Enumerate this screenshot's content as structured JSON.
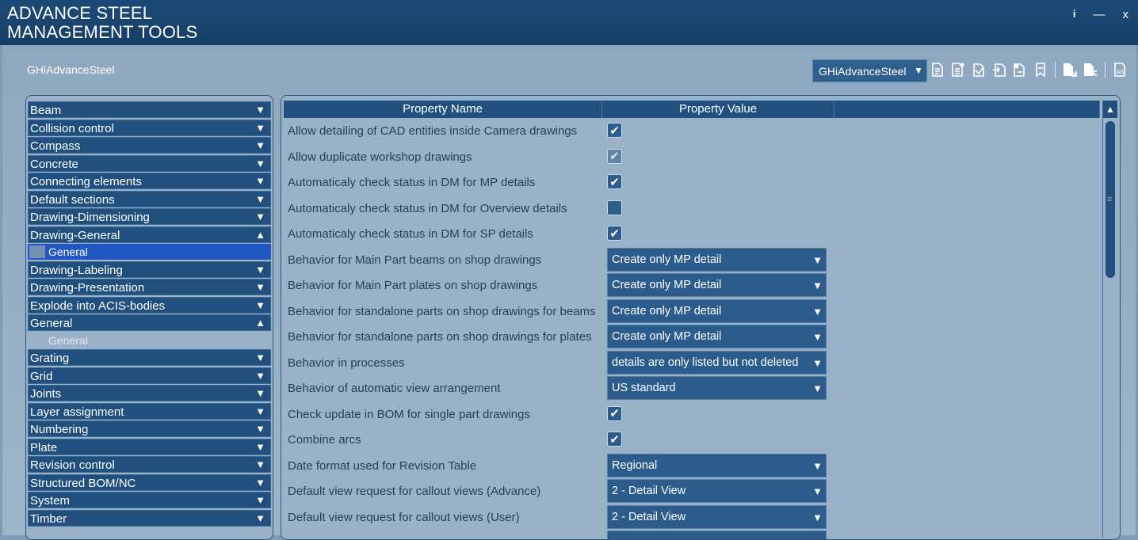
{
  "window": {
    "title_line1": "ADVANCE STEEL",
    "title_line2": "MANAGEMENT TOOLS",
    "info": "i",
    "minimize": "—",
    "close": "x"
  },
  "profile": {
    "label": "GHiAdvanceSteel",
    "selected": "GHiAdvanceSteel",
    "arrow": "▼"
  },
  "categories": [
    {
      "label": "Beam",
      "chevron": "▼"
    },
    {
      "label": "Collision control",
      "chevron": "▼"
    },
    {
      "label": "Compass",
      "chevron": "▼"
    },
    {
      "label": "Concrete",
      "chevron": "▼"
    },
    {
      "label": "Connecting elements",
      "chevron": "▼"
    },
    {
      "label": "Default sections",
      "chevron": "▼"
    },
    {
      "label": "Drawing-Dimensioning",
      "chevron": "▼"
    },
    {
      "label": "Drawing-General",
      "chevron": "▲",
      "sub": "General"
    },
    {
      "label": "Drawing-Labeling",
      "chevron": "▼"
    },
    {
      "label": "Drawing-Presentation",
      "chevron": "▼"
    },
    {
      "label": "Explode into ACIS-bodies",
      "chevron": "▼"
    },
    {
      "label": "General",
      "chevron": "▲",
      "sub": "General"
    },
    {
      "label": "Grating",
      "chevron": "▼"
    },
    {
      "label": "Grid",
      "chevron": "▼"
    },
    {
      "label": "Joints",
      "chevron": "▼"
    },
    {
      "label": "Layer assignment",
      "chevron": "▼"
    },
    {
      "label": "Numbering",
      "chevron": "▼"
    },
    {
      "label": "Plate",
      "chevron": "▼"
    },
    {
      "label": "Revision control",
      "chevron": "▼"
    },
    {
      "label": "Structured BOM/NC",
      "chevron": "▼"
    },
    {
      "label": "System",
      "chevron": "▼"
    },
    {
      "label": "Timber",
      "chevron": "▼"
    }
  ],
  "grid": {
    "col_name": "Property Name",
    "col_value": "Property Value",
    "rows": [
      {
        "name": "Allow detailing of CAD entities inside Camera drawings",
        "checked": true
      },
      {
        "name": "Allow duplicate workshop drawings",
        "checked": true,
        "dim": true
      },
      {
        "name": "Automaticaly check status in DM for MP details",
        "checked": true
      },
      {
        "name": "Automaticaly check status in DM for Overview details",
        "checked": false
      },
      {
        "name": "Automaticaly check status in DM for SP details",
        "checked": true
      },
      {
        "name": "Behavior for Main Part beams on shop drawings",
        "value": "Create only MP detail"
      },
      {
        "name": "Behavior for Main Part plates on shop drawings",
        "value": "Create only MP detail"
      },
      {
        "name": "Behavior for standalone parts on shop drawings for beams",
        "value": "Create only MP detail"
      },
      {
        "name": "Behavior for standalone parts on shop drawings for plates",
        "value": "Create only MP detail"
      },
      {
        "name": "Behavior in processes",
        "value": "details are only listed but not deleted"
      },
      {
        "name": "Behavior of automatic view arrangement",
        "value": "US standard"
      },
      {
        "name": "Check update in BOM for single part drawings",
        "checked": true
      },
      {
        "name": "Combine arcs",
        "checked": true
      },
      {
        "name": "Date format used for Revision Table",
        "value": "Regional"
      },
      {
        "name": "Default view request for callout views (Advance)",
        "value": "2 - Detail View"
      },
      {
        "name": "Default view request for callout views (User)",
        "value": "2 - Detail View"
      },
      {
        "name": "",
        "value": ""
      }
    ]
  },
  "toolbar_icons": [
    "tool-icon-1",
    "tool-icon-2",
    "tool-icon-3",
    "tool-icon-4",
    "tool-icon-5",
    "tool-icon-6",
    "tool-icon-7",
    "tool-icon-8",
    "as-icon"
  ],
  "scroll": {
    "up": "▲",
    "grip": "≡"
  },
  "colors": {
    "accent": "#21507f",
    "selection": "#2256c2",
    "background": "#9ab2c7"
  }
}
